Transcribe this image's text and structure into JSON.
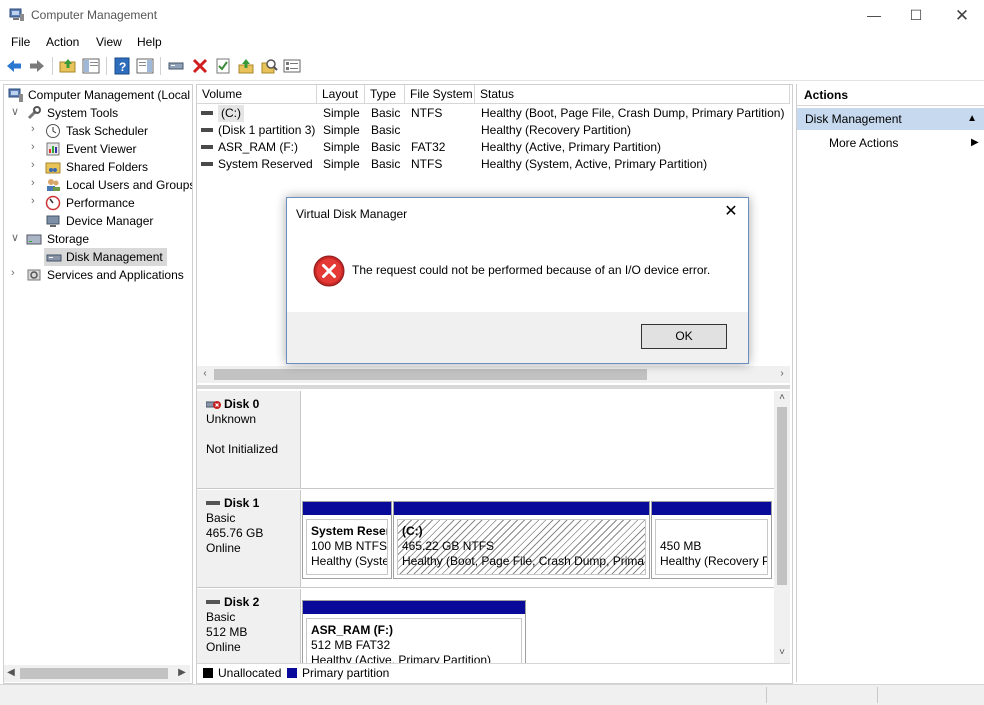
{
  "window": {
    "title": "Computer Management"
  },
  "menu": [
    "File",
    "Action",
    "View",
    "Help"
  ],
  "tree": [
    {
      "label": "Computer Management (Local",
      "icon": "computer-management-icon",
      "chevron": ""
    },
    {
      "label": "System Tools",
      "icon": "system-tools-icon",
      "chevron": "expanded"
    },
    {
      "label": "Task Scheduler",
      "icon": "clock-icon",
      "chevron": "collapsed"
    },
    {
      "label": "Event Viewer",
      "icon": "event-viewer-icon",
      "chevron": "collapsed"
    },
    {
      "label": "Shared Folders",
      "icon": "shared-folder-icon",
      "chevron": "collapsed"
    },
    {
      "label": "Local Users and Groups",
      "icon": "users-icon",
      "chevron": "collapsed"
    },
    {
      "label": "Performance",
      "icon": "performance-icon",
      "chevron": "collapsed"
    },
    {
      "label": "Device Manager",
      "icon": "device-manager-icon",
      "chevron": ""
    },
    {
      "label": "Storage",
      "icon": "storage-icon",
      "chevron": "expanded"
    },
    {
      "label": "Disk Management",
      "icon": "disk-icon",
      "chevron": ""
    },
    {
      "label": "Services and Applications",
      "icon": "services-icon",
      "chevron": "collapsed"
    }
  ],
  "volume_table": {
    "headers": [
      "Volume",
      "Layout",
      "Type",
      "File System",
      "Status"
    ],
    "rows": [
      {
        "volume": "(C:)",
        "layout": "Simple",
        "type": "Basic",
        "fs": "NTFS",
        "status": "Healthy (Boot, Page File, Crash Dump, Primary Partition)"
      },
      {
        "volume": "(Disk 1 partition 3)",
        "layout": "Simple",
        "type": "Basic",
        "fs": "",
        "status": "Healthy (Recovery Partition)"
      },
      {
        "volume": "ASR_RAM (F:)",
        "layout": "Simple",
        "type": "Basic",
        "fs": "FAT32",
        "status": "Healthy (Active, Primary Partition)"
      },
      {
        "volume": "System Reserved",
        "layout": "Simple",
        "type": "Basic",
        "fs": "NTFS",
        "status": "Healthy (System, Active, Primary Partition)"
      }
    ]
  },
  "disks": [
    {
      "name": "Disk 0",
      "line1": "Unknown",
      "line2": "",
      "line3": "Not Initialized"
    },
    {
      "name": "Disk 1",
      "line1": "Basic",
      "line2": "465.76 GB",
      "line3": "Online",
      "partitions": [
        {
          "title": "System Reser",
          "size": "100 MB NTFS",
          "status": "Healthy (Syste"
        },
        {
          "title": "(C:)",
          "size": "465.22 GB NTFS",
          "status": "Healthy (Boot, Page File, Crash Dump, Primary"
        },
        {
          "title": "",
          "size": "450 MB",
          "status": "Healthy (Recovery P"
        }
      ]
    },
    {
      "name": "Disk 2",
      "line1": "Basic",
      "line2": "512 MB",
      "line3": "Online",
      "partitions": [
        {
          "title": "ASR_RAM  (F:)",
          "size": "512 MB FAT32",
          "status": "Healthy (Active, Primary Partition)"
        }
      ]
    }
  ],
  "legend": {
    "unallocated": "Unallocated",
    "primary": "Primary partition"
  },
  "actions": {
    "header": "Actions",
    "section": "Disk Management",
    "more": "More Actions"
  },
  "dialog": {
    "title": "Virtual Disk Manager",
    "message": "The request could not be performed because of an I/O device error.",
    "ok": "OK"
  },
  "colors": {
    "primary_partition": "#0a0a9a",
    "selection": "#c6d9ee",
    "error": "#d32f2f"
  }
}
